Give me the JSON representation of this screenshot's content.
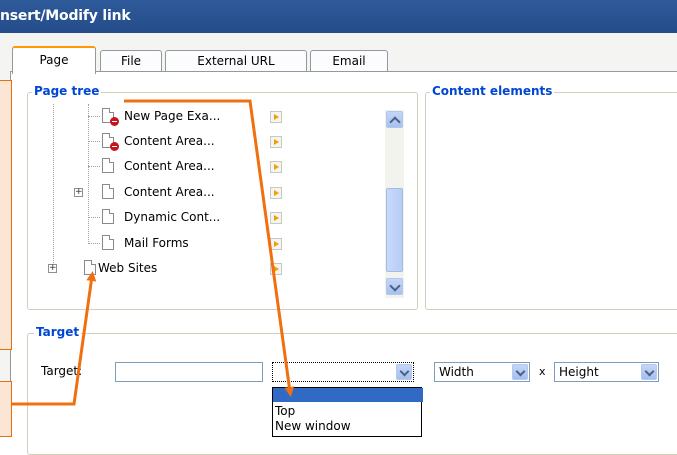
{
  "window": {
    "title": "nsert/Modify link"
  },
  "tabs": [
    {
      "label": "Page",
      "active": true
    },
    {
      "label": "File",
      "active": false
    },
    {
      "label": "External URL",
      "active": false
    },
    {
      "label": "Email",
      "active": false
    }
  ],
  "page_tree": {
    "legend": "Page tree",
    "items": [
      {
        "label": "New Page Exa...",
        "deleted": true
      },
      {
        "label": "Content Area...",
        "deleted": true
      },
      {
        "label": "Content Area...",
        "deleted": false
      },
      {
        "label": "Content Area...",
        "deleted": false,
        "expandable": true
      },
      {
        "label": "Dynamic Cont...",
        "deleted": false
      },
      {
        "label": "Mail Forms",
        "deleted": false
      },
      {
        "label": "Web Sites",
        "deleted": false,
        "expandable": true
      }
    ]
  },
  "content_elements": {
    "legend": "Content elements"
  },
  "target": {
    "legend": "Target",
    "label": "Target:",
    "input_value": "",
    "select_value": "",
    "width_label": "Width",
    "times": "x",
    "height_label": "Height",
    "dropdown_options": [
      "",
      "Top",
      "New window"
    ]
  },
  "colors": {
    "accent": "#ff9900",
    "annotation": "#f07010",
    "legend": "#0046d5",
    "titlebar": "#2a5496"
  }
}
